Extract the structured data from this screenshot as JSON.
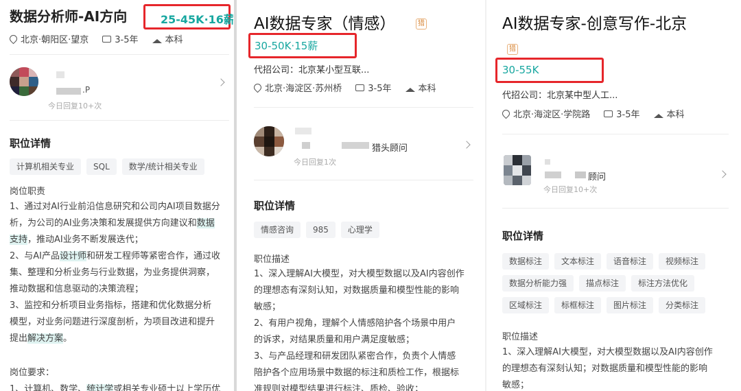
{
  "panel1": {
    "title": "数据分析师-AI方向",
    "salary": "25-45K·16薪",
    "meta": {
      "location": "北京·朝阳区·望京",
      "experience": "3-5年",
      "education": "本科"
    },
    "recruiter": {
      "name_suffix": ".P",
      "reply": "今日回复10+次"
    },
    "section_title": "职位详情",
    "tags": [
      "计算机相关专业",
      "SQL",
      "数学/统计相关专业"
    ],
    "desc_heading": "岗位职责",
    "lines": [
      "1、通过对AI行业前沿信息研究和公司内AI项目数据分",
      "析，为公司的AI业务决策和发展提供方向建议和",
      "数据",
      "支持",
      "，推动AI业务不断发展迭代；",
      "2、与AI产品",
      "设计师",
      "和研发工程师等紧密合作，通过收",
      "集、整理和分析业务与行业数据，为业务提供洞察，",
      "推动数据和信息驱动的决策流程；",
      "3、监控和分析项目业务指标，搭建和优化数据分析",
      "模型，对业务问题进行深度剖析，为项目改进和提升",
      "提出",
      "解决方案",
      "。"
    ],
    "req_heading": "岗位要求：",
    "req_line_a": "1、计算机、数学、",
    "req_line_hl": "统计学",
    "req_line_b": "或相关专业硕士以上学历优"
  },
  "panel2": {
    "title": "AI数据专家（情感）",
    "badge": "猎",
    "salary": "30-50K·15薪",
    "company": "代招公司：北京某小型互联...",
    "meta": {
      "location": "北京·海淀区·苏州桥",
      "experience": "3-5年",
      "education": "本科"
    },
    "recruiter": {
      "role": "猎头顾问",
      "reply": "今日回复1次"
    },
    "section_title": "职位详情",
    "tags": [
      "情感咨询",
      "985",
      "心理学"
    ],
    "desc_heading": "职位描述",
    "lines": [
      "1、深入理解AI大模型，对大模型数据以及AI内容创作",
      "的理想态有深刻认知，对数据质量和模型性能的影响",
      "敏感；",
      "2、有用户视角，理解个人情感陪护各个场景中用户",
      "的诉求，对结果质量和用户满足度敏感；",
      "3、与产品经理和研发团队紧密合作，负责个人情感",
      "陪护各个应用场景中数据的标注和质检工作，根据标",
      "准规则对模型结果进行标注、质检、验收；"
    ]
  },
  "panel3": {
    "title": "AI数据专家-创意写作-北京",
    "badge": "猎",
    "salary": "30-55K",
    "company": "代招公司：北京某中型人工...",
    "meta": {
      "location": "北京·海淀区·学院路",
      "experience": "3-5年",
      "education": "本科"
    },
    "recruiter": {
      "role": "顾问",
      "reply": "今日回复10+次"
    },
    "section_title": "职位详情",
    "tags": [
      "数据标注",
      "文本标注",
      "语音标注",
      "视频标注",
      "数据分析能力强",
      "描点标注",
      "标注方法优化",
      "区域标注",
      "标框标注",
      "图片标注",
      "分类标注"
    ],
    "desc_heading": "职位描述",
    "lines": [
      "1、深入理解AI大模型，对大模型数据以及AI内容创作",
      "的理想态有深刻认知；对数据质量和模型性能的影响",
      "敏感；"
    ]
  },
  "colors": {
    "accent": "#17a7a0",
    "highlight_box": "#e6262b"
  }
}
